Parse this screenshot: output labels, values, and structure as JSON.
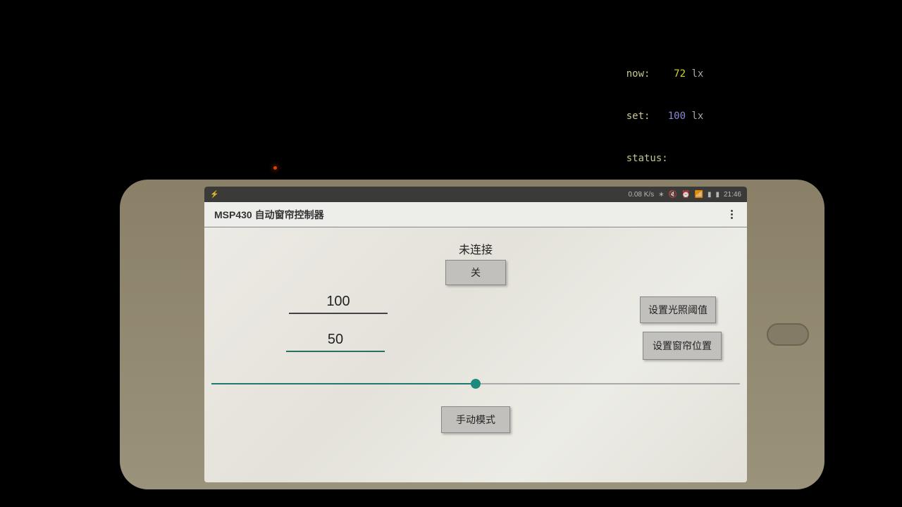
{
  "background": {
    "terminal": {
      "now_label": "now:",
      "now_value": "72",
      "now_unit": "lx",
      "set_label": "set:",
      "set_value": "100",
      "set_unit": "lx",
      "status_label": "status:",
      "status_value": ""
    }
  },
  "phone": {
    "statusbar": {
      "speed": "0.08 K/s",
      "time": "21:46"
    },
    "appbar": {
      "title": "MSP430 自动窗帘控制器"
    },
    "content": {
      "connection_status": "未连接",
      "toggle_label": "关",
      "light_threshold_value": "100",
      "set_light_threshold_label": "设置光照阈值",
      "curtain_position_value": "50",
      "set_curtain_position_label": "设置窗帘位置",
      "slider_percent": 50,
      "mode_label": "手动模式"
    }
  }
}
